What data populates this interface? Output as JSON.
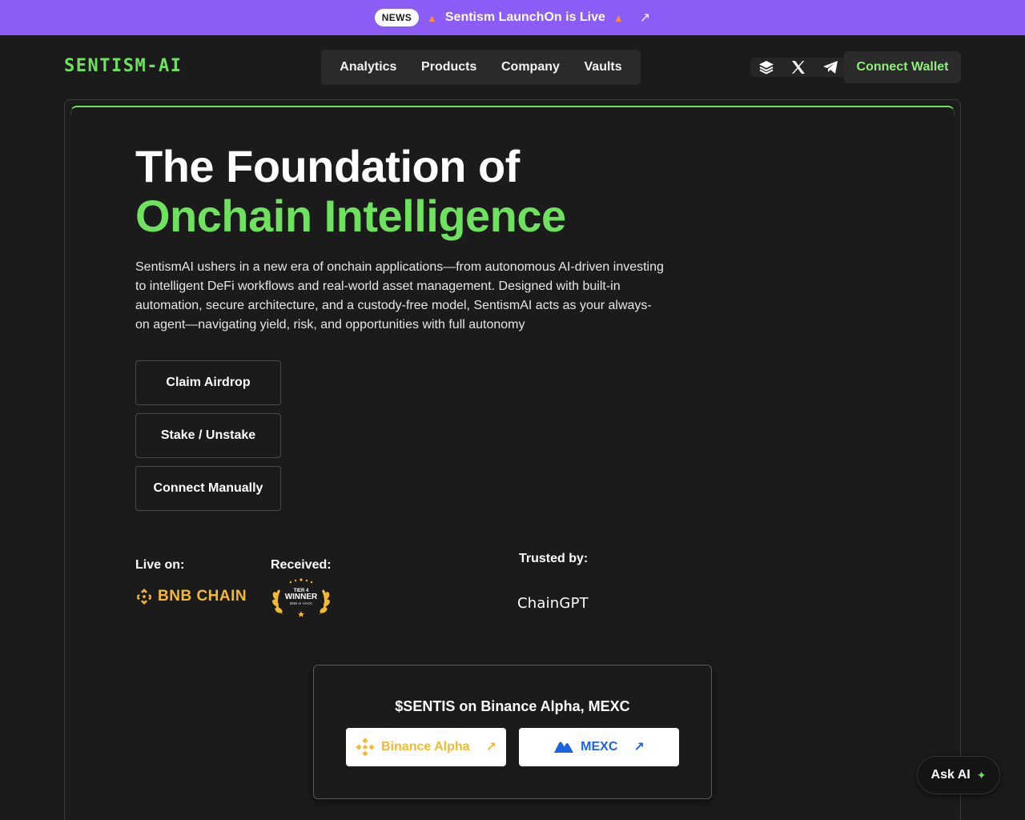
{
  "newsbar": {
    "badge": "NEWS",
    "text": "Sentism LaunchOn is Live",
    "bg_color": "#8b5cf6"
  },
  "header": {
    "logo": "SENTISM-AI",
    "nav": [
      "Analytics",
      "Products",
      "Company",
      "Vaults"
    ],
    "social_icons": [
      "layers-icon",
      "x-icon",
      "telegram-icon"
    ],
    "connect_wallet": "Connect Wallet"
  },
  "hero": {
    "headline_line1": "The Foundation of",
    "headline_line2": "Onchain Intelligence",
    "description": "SentismAI ushers in a new era of onchain applications—from autonomous AI-driven investing to intelligent DeFi workflows and real-world asset management. Designed with built-in automation, secure architecture, and a custody-free model, SentismAI acts as your always-on agent—navigating yield, risk, and opportunities with full autonomy",
    "buttons": [
      "Claim Airdrop",
      "Stake / Unstake",
      "Connect Manually"
    ],
    "live_on_label": "Live on:",
    "live_on_chain": "BNB CHAIN",
    "received_label": "Received:",
    "award": {
      "tier": "TIER 4",
      "title": "WINNER",
      "sub": "BNB AI HACK"
    },
    "trusted_label": "Trusted by:",
    "trusted_partner": "ChainGPT"
  },
  "exchanges": {
    "title": "$SENTIS on Binance Alpha, MEXC",
    "items": [
      {
        "label": "Binance Alpha",
        "color": "#f3ba2f"
      },
      {
        "label": "MEXC",
        "color": "#1d63e0"
      }
    ]
  },
  "ask_ai": "Ask AI",
  "colors": {
    "accent": "#6ee25f",
    "background": "#1b1b1b",
    "bnb": "#f3ba2f"
  }
}
